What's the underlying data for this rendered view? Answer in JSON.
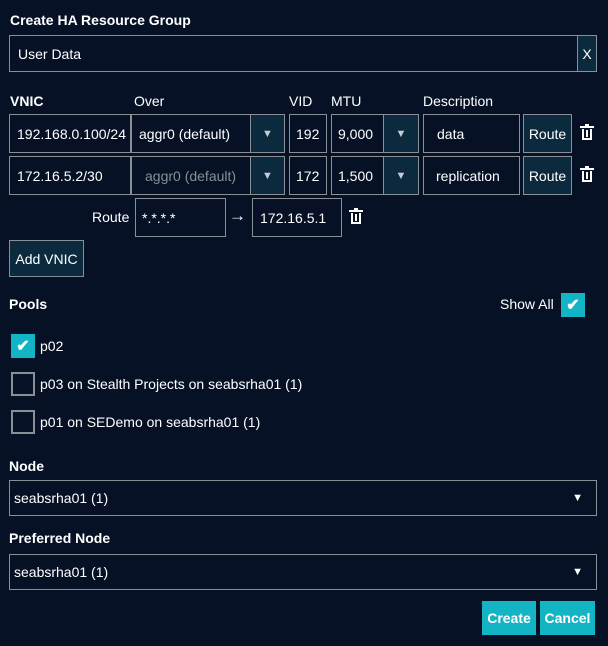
{
  "title": "Create HA Resource Group",
  "name_input": {
    "value": "User Data",
    "clear_label": "X"
  },
  "vnic_headers": {
    "vnic": "VNIC",
    "over": "Over",
    "vid": "VID",
    "mtu": "MTU",
    "description": "Description"
  },
  "vnics": [
    {
      "ip": "192.168.0.100/24",
      "over": "aggr0 (default)",
      "over_disabled": false,
      "vid": "192",
      "mtu": "9,000",
      "description": "data",
      "route_label": "Route"
    },
    {
      "ip": "172.16.5.2/30",
      "over": "aggr0 (default)",
      "over_disabled": true,
      "vid": "172",
      "mtu": "1,500",
      "description": "replication",
      "route_label": "Route"
    }
  ],
  "route": {
    "label": "Route",
    "destination": "*.*.*.*",
    "gateway": "172.16.5.1"
  },
  "add_vnic_label": "Add VNIC",
  "pools": {
    "label": "Pools",
    "show_all_label": "Show All",
    "show_all_checked": true,
    "items": [
      {
        "label": "p02",
        "checked": true
      },
      {
        "label": "p03 on Stealth Projects on seabsrha01 (1)",
        "checked": false
      },
      {
        "label": "p01 on SEDemo on seabsrha01 (1)",
        "checked": false
      }
    ]
  },
  "node": {
    "label": "Node",
    "value": "seabsrha01 (1)"
  },
  "preferred_node": {
    "label": "Preferred Node",
    "value": "seabsrha01 (1)"
  },
  "buttons": {
    "create": "Create",
    "cancel": "Cancel"
  },
  "colors": {
    "background": "#061126",
    "accent": "#13b5c4",
    "button": "#0c2a3e",
    "border": "#8a8f96"
  }
}
